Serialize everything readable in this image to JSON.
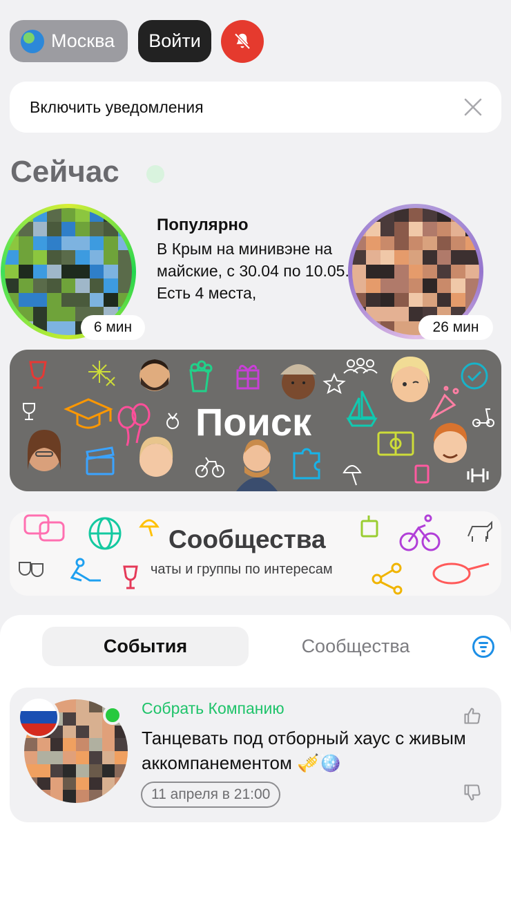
{
  "header": {
    "city_label": "Москва",
    "login_label": "Войти"
  },
  "notifications_bar": {
    "text": "Включить уведомления"
  },
  "now": {
    "title": "Сейчас"
  },
  "stories": [
    {
      "time": "6 мин"
    },
    {
      "time": "26 мин"
    }
  ],
  "popular": {
    "title": "Популярно",
    "text": "В Крым на минивэне на майские, с 30.04 по 10.05. Есть 4 места,"
  },
  "search_banner": {
    "title": "Поиск"
  },
  "communities_banner": {
    "title": "Сообщества",
    "subtitle": "чаты и группы по интересам"
  },
  "tabs": [
    {
      "label": "События",
      "active": true
    },
    {
      "label": "Сообщества",
      "active": false
    }
  ],
  "event": {
    "category": "Собрать Компанию",
    "title": "Танцевать под отборный хаус с живым аккомпанементом 🎺🪩",
    "date": "11 апреля в 21:00"
  },
  "colors": {
    "mute_button": "#e53a2e",
    "category_green": "#1fc36a",
    "filter_blue": "#1d8fe6"
  }
}
